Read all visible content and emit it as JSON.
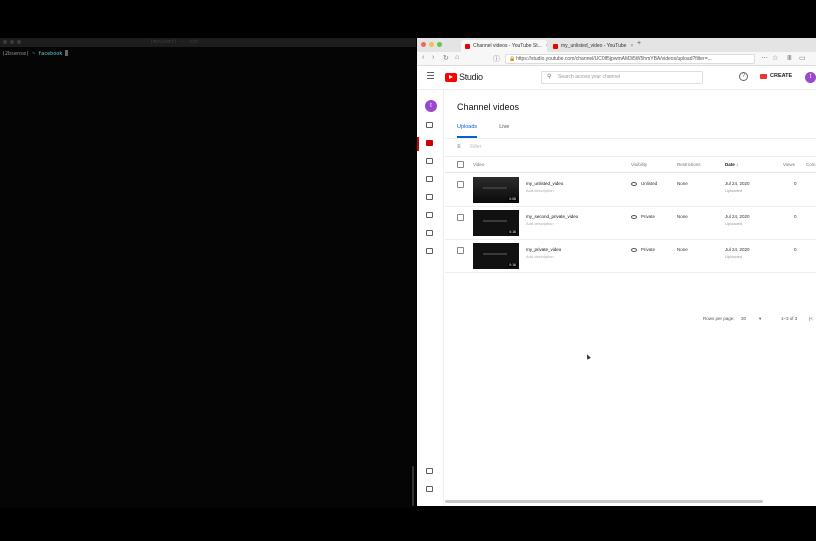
{
  "terminal": {
    "title": "(moviemr) — -zsh",
    "prompt": "(2bsense) ~",
    "command": "facebook"
  },
  "browser": {
    "tabs": [
      {
        "label": "Channel videos - YouTube St...",
        "active": true
      },
      {
        "label": "my_unlisted_video - YouTube",
        "active": false
      }
    ],
    "new_tab": "+",
    "url": "https://studio.youtube.com/channel/UC0lf5jpwmAM3i5W5hmYBA/videos/upload?filter=..."
  },
  "studio": {
    "logo_text": "Studio",
    "search_placeholder": "Search across your channel",
    "help": "?",
    "create_label": "CREATE",
    "avatar_letter": "t",
    "page_title": "Channel videos",
    "tabs": [
      "Uploads",
      "Live"
    ],
    "filter_label": "Filter",
    "columns": {
      "video": "Video",
      "visibility": "Visibility",
      "restrictions": "Restrictions",
      "date": "Date ↓",
      "views": "Views",
      "comments": "Com"
    },
    "rows": [
      {
        "title": "my_unlisted_video",
        "desc": "Add description",
        "duration": "0:08",
        "visibility": "Unlisted",
        "restrictions": "None",
        "date": "Jul 24, 2020",
        "date_sub": "Uploaded",
        "views": "0"
      },
      {
        "title": "my_second_private_video",
        "desc": "Add description",
        "duration": "0:16",
        "visibility": "Private",
        "restrictions": "None",
        "date": "Jul 24, 2020",
        "date_sub": "Uploaded",
        "views": "0"
      },
      {
        "title": "my_private_video",
        "desc": "Add description",
        "duration": "0:16",
        "visibility": "Private",
        "restrictions": "None",
        "date": "Jul 24, 2020",
        "date_sub": "Uploaded",
        "views": "0"
      }
    ],
    "pager": {
      "rows_label": "Rows per page:",
      "rows_value": "30",
      "range": "1–3 of 3",
      "first": "|<"
    }
  },
  "colors": {
    "accent": "#065fd4",
    "brand_red": "#ff0000",
    "avatar": "#9a48d0"
  }
}
